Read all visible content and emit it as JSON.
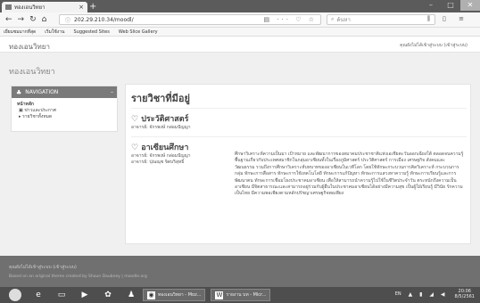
{
  "browser": {
    "tab_title": "ทองเอนวิทยา",
    "tab_close": "×",
    "new_tab": "+",
    "url": "202.29.210.34/moodl/",
    "search_placeholder": "ค้นหา",
    "bookmarks": [
      "เยี่ยมชมมากที่สุด",
      "เริ่มใช้งาน",
      "Suggested Sites",
      "Web Slice Gallery"
    ]
  },
  "site": {
    "name": "ทองเอนวิทยา",
    "user_info": "คุณยังไม่ได้เข้าสู่ระบบ (เข้าสู่ระบบ)"
  },
  "page": {
    "title": "ทองเอนวิทยา"
  },
  "navigation": {
    "header": "NAVIGATION",
    "items": [
      "หน้าหลัก",
      "ข่าวและประกาศ",
      "รายวิชาทั้งหมด"
    ]
  },
  "main": {
    "title": "รายวิชาที่มีอยู่",
    "courses": [
      {
        "name": "ประวัติศาสตร์",
        "teachers": [
          "อาจารย์: จักรพงษ์ กล่อมปัญญา"
        ],
        "summary": ""
      },
      {
        "name": "อาเซียนศึกษา",
        "teachers": [
          "อาจารย์: จักรพงษ์ กล่อมปัญญา",
          "อาจารย์: ปุณณุช จิตบริสุทธิ์"
        ],
        "summary": "ศึกษาวิเคราะห์ความเป็นมา เป้าหมาย และพัฒนาการของสมาคมประชาชาติแห่งเอเชียตะวันออกเฉียงใต้ ตลอดจนความรู้พื้นฐานเกี่ยวกับประเทศสมาชิกในกลุ่มอาเซียนทั้งในเรื่องภูมิศาสตร์ ประวัติศาสตร์ การเมือง เศรษฐกิจ สังคมและวัฒนธรรม รวมถึงการศึกษาวิเคราะห์บทบาทของอาเซียนในเวทีโลก โดยใช้ทักษะกระบวนการคิดวิเคราะห์ กระบวนการกลุ่ม ทักษะการสื่อสาร ทักษะการใช้เทคโนโลยี ทักษะการแก้ปัญหา ทักษะการแสวงหาความรู้ ทักษะการเรียนรู้และการพัฒนาตน ทักษะการเชื่อมโยงประชาคมอาเซียน เพื่อให้สามารถนำความรู้ไปใช้ในชีวิตประจำวัน ตระหนักถึงความเป็นอาเซียน มีจิตสาธารณะและสามารถอยู่ร่วมกับผู้อื่นในประชาคมอาเซียนได้อย่างมีความสุข เป็นผู้ใฝ่เรียนรู้ มีวินัย รักความเป็นไทย มีความพอเพียงตามหลักปรัชญาเศรษฐกิจพอเพียง"
      }
    ]
  },
  "footer": {
    "line1": "คุณยังไม่ได้เข้าสู่ระบบ (เข้าสู่ระบบ)",
    "line2": "Based on an original theme created by Shaun Daubney | moodle.org"
  },
  "taskbar": {
    "tasks": [
      "ทองเอนวิทยา - Moz...",
      "รายงาน บท - Micr..."
    ],
    "lang": "EN",
    "time": "20:06",
    "date": "8/5/2561"
  }
}
